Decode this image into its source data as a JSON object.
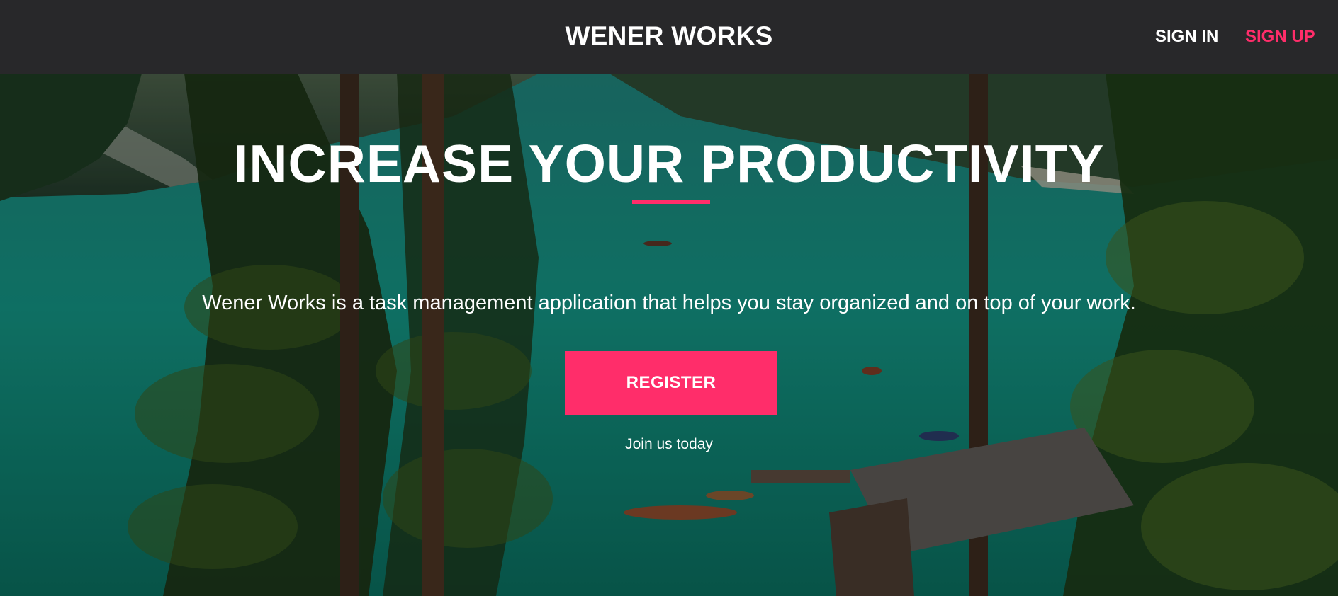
{
  "header": {
    "brand": "WENER WORKS",
    "sign_in": "SIGN IN",
    "sign_up": "SIGN UP"
  },
  "hero": {
    "headline": "INCREASE YOUR PRODUCTIVITY",
    "tagline": "Wener Works is a task management application that helps you stay organized and on top of your work.",
    "register_label": "REGISTER",
    "subtext": "Join us today"
  },
  "colors": {
    "header_bg": "#28282a",
    "accent": "#ff2d6a",
    "text": "#ffffff"
  }
}
